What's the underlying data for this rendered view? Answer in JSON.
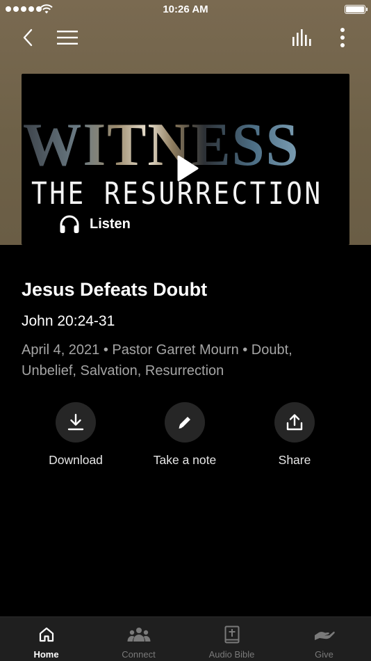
{
  "status_bar": {
    "time": "10:26 AM"
  },
  "nav": {
    "back_icon": "chevron-left-icon",
    "menu_icon": "hamburger-menu-icon",
    "equalizer_icon": "audio-bars-icon",
    "more_icon": "more-vertical-icon"
  },
  "artwork": {
    "title": "WITNESS",
    "subtitle": "THE RESURRECTION",
    "play_icon": "play-icon",
    "listen_label": "Listen",
    "listen_icon": "headphones-icon"
  },
  "sermon": {
    "title": "Jesus Defeats Doubt",
    "scripture": "John 20:24-31",
    "meta": "April 4, 2021 • Pastor Garret Mourn • Doubt, Unbelief, Salvation, Resurrection"
  },
  "actions": [
    {
      "label": "Download",
      "icon": "download-icon"
    },
    {
      "label": "Take a note",
      "icon": "pencil-icon"
    },
    {
      "label": "Share",
      "icon": "share-icon"
    }
  ],
  "tabs": [
    {
      "label": "Home",
      "icon": "home-icon",
      "active": true
    },
    {
      "label": "Connect",
      "icon": "people-icon",
      "active": false
    },
    {
      "label": "Audio Bible",
      "icon": "bible-icon",
      "active": false
    },
    {
      "label": "Give",
      "icon": "giving-hand-icon",
      "active": false
    }
  ],
  "colors": {
    "header_background": "#6e6148",
    "page_background": "#000000",
    "action_circle": "#262626",
    "tab_bar": "#1f1f1f",
    "meta_text": "#a5a5a5",
    "tab_inactive": "#7a7a7a"
  }
}
